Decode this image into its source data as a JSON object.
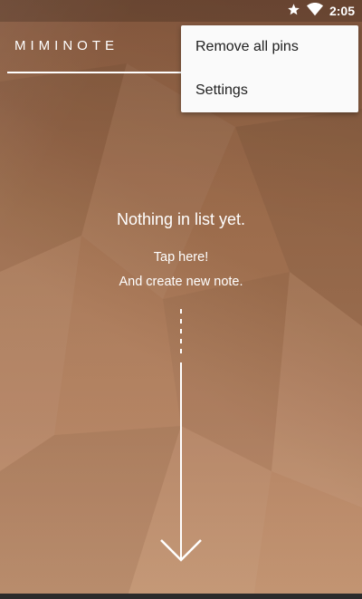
{
  "status_bar": {
    "time": "2:05",
    "icons": [
      "star-icon",
      "wifi-icon"
    ]
  },
  "app": {
    "title": "MIMINOTE"
  },
  "overflow_menu": {
    "items": [
      {
        "label": "Remove all pins"
      },
      {
        "label": "Settings"
      }
    ]
  },
  "empty_state": {
    "title": "Nothing in list yet.",
    "line1": "Tap here!",
    "line2": "And create new note."
  },
  "colors": {
    "background_top": "#8f5f43",
    "background_bottom": "#c08f6b",
    "menu_bg": "#fafafa",
    "text_light": "#ffffff"
  }
}
